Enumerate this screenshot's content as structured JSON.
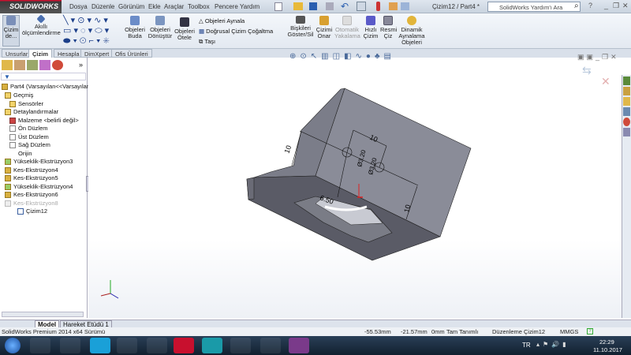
{
  "app": {
    "logo": "SOLIDWORKS",
    "document_title": "Çizim12 / Part4 *",
    "help_search_placeholder": "SolidWorks Yardım'ı Ara"
  },
  "menu": [
    "Dosya",
    "Düzenle",
    "Görünüm",
    "Ekle",
    "Araçlar",
    "Toolbox",
    "Pencere",
    "Yardım"
  ],
  "ribbon": {
    "sketch": "Çizim de...",
    "smart_dim": "Akıllı ölçümlendirme",
    "trim": "Objeleri Buda",
    "convert": "Objeleri Dönüştür",
    "offset": "Objeleri Ötele",
    "mirror": "Objeleri Aynala",
    "linear_pattern": "Doğrusal Çizim Çoğaltma",
    "move": "Taşı",
    "show_relations": "Bişkileri Göster/Sil",
    "repair": "Çizimi Onar",
    "auto_snap": "Otomatik Yakalama",
    "rapid_sketch": "Hızlı Çizim",
    "sketch_picture": "Resmi Çiz",
    "dynamic_mirror": "Dinamik Aynalama Objeleri"
  },
  "tabs": [
    "Unsurlar",
    "Çizim",
    "Hesapla",
    "DimXpert",
    "Ofis Ürünleri"
  ],
  "active_tab": "Çizim",
  "tree": {
    "root": "Part4  (Varsayılan<<Varsayılan>",
    "items": [
      "Geçmiş",
      "Sensörler",
      "Detaylandırmalar",
      "Malzeme <belirli değil>",
      "Ön Düzlem",
      "Üst Düzlem",
      "Sağ Düzlem",
      "Orijin",
      "Yükseklik-Ekstrüzyon3",
      "Kes-Ekstrüzyon4",
      "Kes-Ekstrüzyon5",
      "Yükseklik-Ekstrüzyon4",
      "Kes-Ekstrüzyon6",
      "Kes-Ekstrüzyon8"
    ],
    "sub": "Çizim12"
  },
  "dimensions": {
    "d1": "10",
    "d2": "10",
    "d3": "Ø3.20",
    "d4": "Ø3.20",
    "d5": "6.50",
    "d6": "10"
  },
  "bottom_tabs": [
    "Model",
    "Hareket Etüdü 1"
  ],
  "status": {
    "version": "SolidWorks Premium 2014 x64 Sürümü",
    "x": "-55.53mm",
    "y": "-21.57mm",
    "z": "0mm",
    "state": "Tam Tanımlı",
    "editing": "Düzenleme Çizim12",
    "units": "MMGS"
  },
  "taskbar": {
    "lang": "TR",
    "time": "22:29",
    "date": "11.10.2017"
  },
  "colors": {
    "face_light": "#8a8c98",
    "face_mid": "#6e707c",
    "face_dark": "#4f505a",
    "accent": "#c8102e"
  }
}
